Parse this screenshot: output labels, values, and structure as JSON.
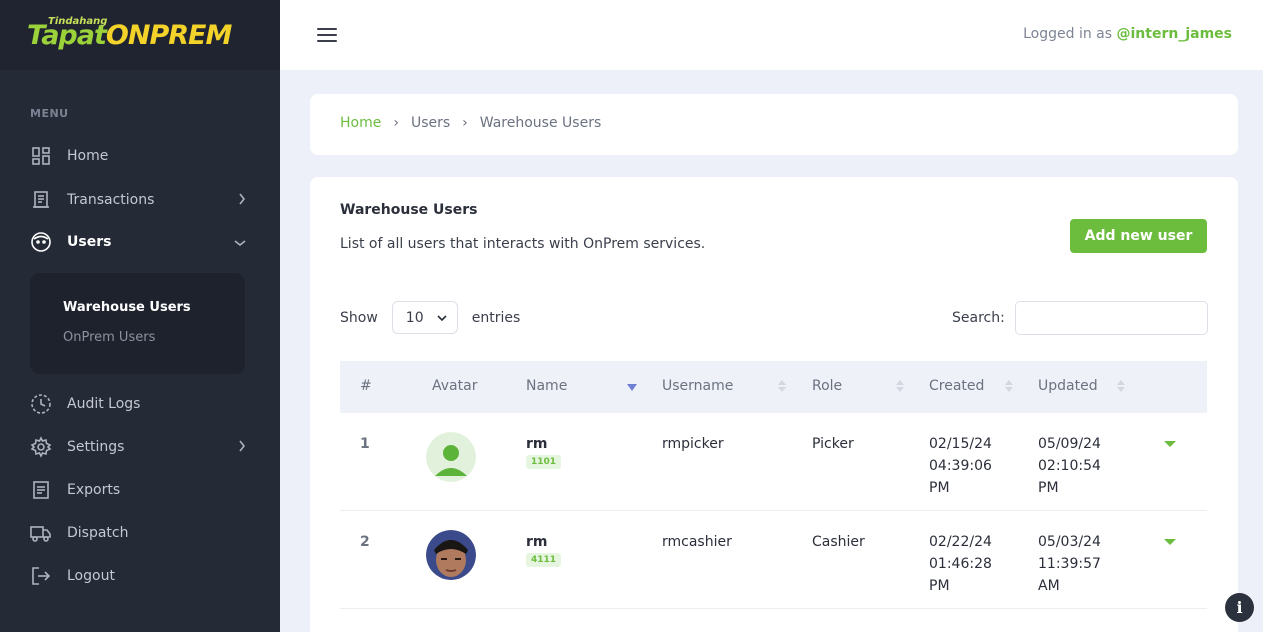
{
  "brand": {
    "small": "Tindahang",
    "tapat": "Tapat",
    "onprem": "ONPREM"
  },
  "sidebar": {
    "menu_label": "MENU",
    "items": [
      {
        "label": "Home",
        "icon": "dashboard-icon"
      },
      {
        "label": "Transactions",
        "icon": "receipt-icon"
      },
      {
        "label": "Users",
        "icon": "user-face-icon"
      },
      {
        "label": "Audit Logs",
        "icon": "history-icon"
      },
      {
        "label": "Settings",
        "icon": "gear-icon"
      },
      {
        "label": "Exports",
        "icon": "document-icon"
      },
      {
        "label": "Dispatch",
        "icon": "truck-icon"
      },
      {
        "label": "Logout",
        "icon": "logout-icon"
      }
    ],
    "submenu": [
      "Warehouse Users",
      "OnPrem Users"
    ]
  },
  "header": {
    "logged_prefix": "Logged in as",
    "username": "@intern_james"
  },
  "breadcrumb": {
    "home": "Home",
    "users": "Users",
    "current": "Warehouse Users",
    "separator": "›"
  },
  "main": {
    "title": "Warehouse Users",
    "description": "List of all users that interacts with OnPrem services.",
    "add_button": "Add new user",
    "show_label": "Show",
    "show_value": "10",
    "entries_label": "entries",
    "search_label": "Search:",
    "search_value": ""
  },
  "table": {
    "columns": [
      "#",
      "Avatar",
      "Name",
      "Username",
      "Role",
      "Created",
      "Updated"
    ],
    "sorted_column": "Name",
    "rows": [
      {
        "num": "1",
        "name": "rm",
        "code": "1101",
        "username": "rmpicker",
        "role": "Picker",
        "created": [
          "02/15/24",
          "04:39:06",
          "PM"
        ],
        "updated": [
          "05/09/24",
          "02:10:54",
          "PM"
        ],
        "avatar": "default-avatar"
      },
      {
        "num": "2",
        "name": "rm",
        "code": "4111",
        "username": "rmcashier",
        "role": "Cashier",
        "created": [
          "02/22/24",
          "01:46:28",
          "PM"
        ],
        "updated": [
          "05/03/24",
          "11:39:57",
          "AM"
        ],
        "avatar": "photo-avatar"
      }
    ]
  },
  "colors": {
    "accent": "#6cbd3e",
    "sidebar_bg": "#242a36",
    "page_bg": "#eef0f9"
  },
  "info_button": "i"
}
